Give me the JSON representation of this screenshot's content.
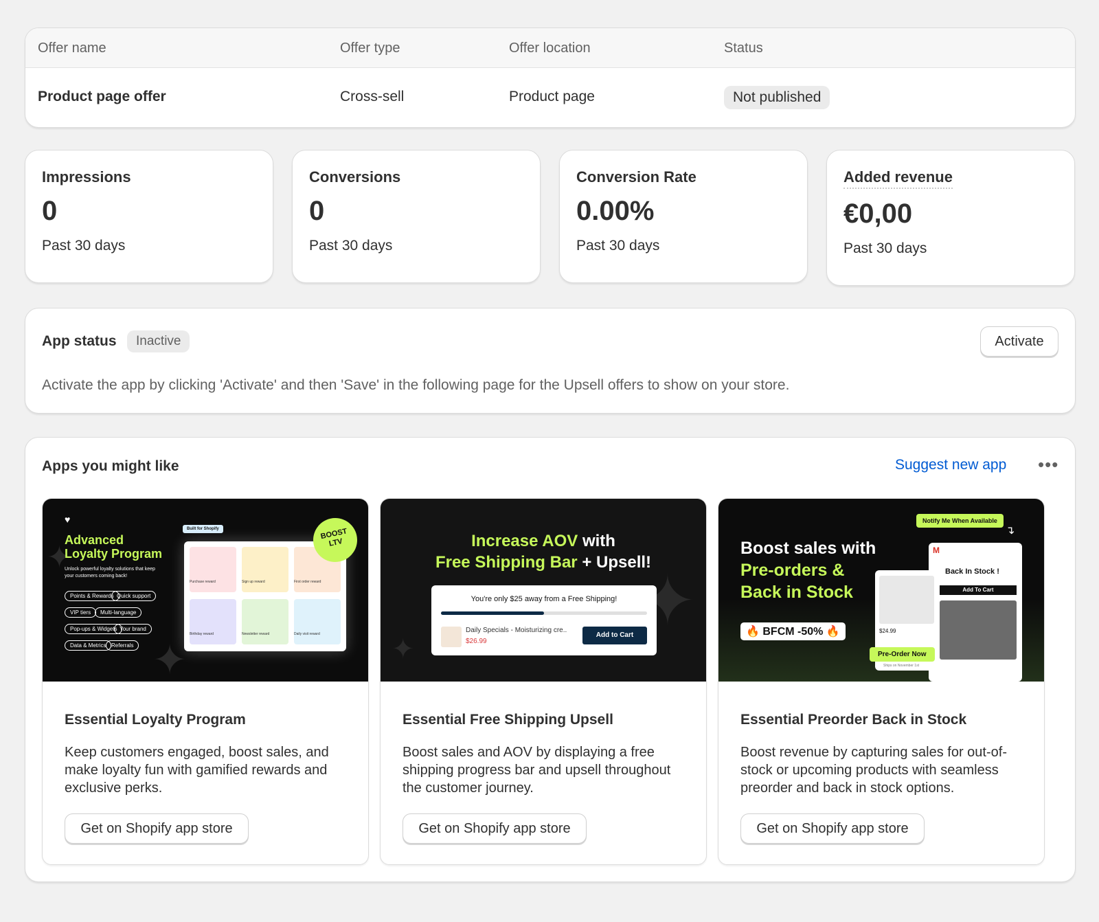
{
  "offer_table": {
    "headers": {
      "name": "Offer name",
      "type": "Offer type",
      "location": "Offer location",
      "status": "Status"
    },
    "row": {
      "name": "Product page offer",
      "type": "Cross-sell",
      "location": "Product page",
      "status": "Not published"
    }
  },
  "metrics": [
    {
      "title": "Impressions",
      "value": "0",
      "period": "Past 30 days"
    },
    {
      "title": "Conversions",
      "value": "0",
      "period": "Past 30 days"
    },
    {
      "title": "Conversion Rate",
      "value": "0.00%",
      "period": "Past 30 days"
    },
    {
      "title": "Added revenue",
      "value": "€0,00",
      "period": "Past 30 days"
    }
  ],
  "app_status": {
    "title": "App status",
    "badge": "Inactive",
    "button": "Activate",
    "description": "Activate the app by clicking 'Activate' and then 'Save' in the following page for the Upsell offers to show on your store."
  },
  "apps": {
    "title": "Apps you might like",
    "suggest_link": "Suggest new app",
    "more_icon": "more-horizontal-icon",
    "items": [
      {
        "name": "Essential Loyalty Program",
        "description": "Keep customers engaged, boost sales, and make loyalty fun with gamified rewards and exclusive perks.",
        "button": "Get on Shopify app store",
        "banner": {
          "title_line1": "Advanced",
          "title_line2": "Loyalty Program",
          "subtitle": "Unlock powerful loyalty solutions that keep your customers coming back!",
          "tags": [
            "Points & Rewards",
            "Quick support",
            "VIP tiers",
            "Multi-language",
            "Pop-ups & Widgets",
            "Your brand",
            "Data & Metrics",
            "Referrals"
          ],
          "badge_line1": "BOOST",
          "badge_line2": "LTV",
          "built_for": "Built for Shopify",
          "tiles": [
            "Purchase reward",
            "Sign up reward",
            "First order reward",
            "Birthday reward",
            "Newsletter reward",
            "Daily visit reward"
          ]
        }
      },
      {
        "name": "Essential Free Shipping Upsell",
        "description": "Boost sales and AOV by displaying a free shipping progress bar and upsell throughout the customer journey.",
        "button": "Get on Shopify app store",
        "banner": {
          "headline_green1": "Increase AOV",
          "headline_white1": "with",
          "headline_green2": "Free Shipping Bar",
          "headline_white2": "+ Upsell!",
          "shipping_text": "You're only $25 away from a Free Shipping!",
          "progress": 0.5,
          "product_name": "Daily Specials - Moisturizing cre..",
          "product_price": "$26.99",
          "cart_button": "Add to Cart"
        }
      },
      {
        "name": "Essential Preorder Back in Stock",
        "description": "Boost revenue by capturing sales for out-of-stock or upcoming products with seamless preorder and back in stock options.",
        "button": "Get on Shopify app store",
        "banner": {
          "headline_white": "Boost sales with",
          "headline_green1": "Pre-orders &",
          "headline_green2": "Back in Stock",
          "promo": "🔥 BFCM -50% 🔥",
          "notify_button": "Notify Me When Available",
          "back_in_stock": "Back In Stock !",
          "add_to_cart": "Add To Cart",
          "price": "$24.99",
          "preorder_button": "Pre-Order Now",
          "ships_on": "Ships on November 1st"
        }
      }
    ]
  }
}
